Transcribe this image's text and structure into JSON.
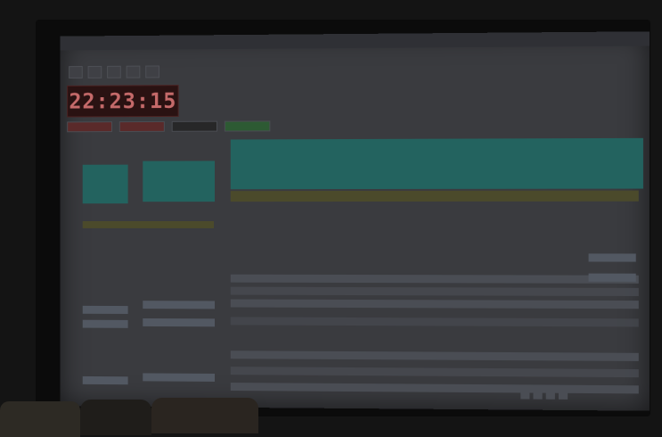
{
  "clock": {
    "time": "22:23:15"
  },
  "colors": {
    "clock_bg": "#2a1212",
    "clock_text": "#c56a6a",
    "teal_highlight": "#23635f",
    "yellow_highlight": "#4b4a2b",
    "grey_row": "#4a4d54"
  }
}
